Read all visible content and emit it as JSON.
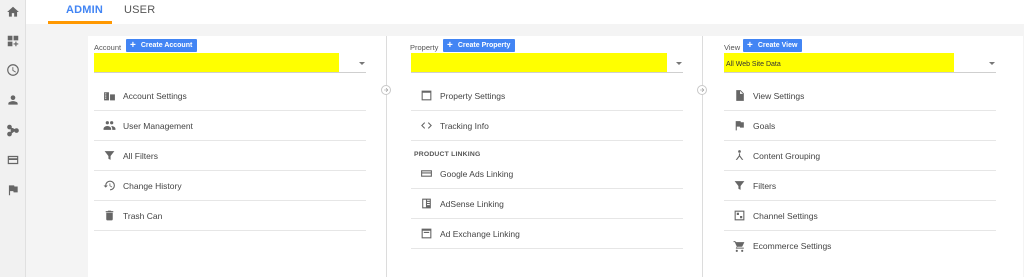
{
  "rail": {
    "icons": [
      "home-icon",
      "dashboard-icon",
      "clock-icon",
      "person-icon",
      "share-icon",
      "card-icon",
      "flag-icon"
    ]
  },
  "tabs": {
    "admin": "ADMIN",
    "user": "USER"
  },
  "account": {
    "label": "Account",
    "create": "Create Account",
    "selected": "",
    "items": [
      {
        "label": "Account Settings",
        "icon": "building-icon"
      },
      {
        "label": "User Management",
        "icon": "people-icon"
      },
      {
        "label": "All Filters",
        "icon": "filter-icon"
      },
      {
        "label": "Change History",
        "icon": "history-icon"
      },
      {
        "label": "Trash Can",
        "icon": "trash-icon"
      }
    ]
  },
  "property": {
    "label": "Property",
    "create": "Create Property",
    "selected": "",
    "items": [
      {
        "label": "Property Settings",
        "icon": "window-icon"
      },
      {
        "label": "Tracking Info",
        "icon": "code-icon"
      }
    ],
    "section": "PRODUCT LINKING",
    "linking": [
      {
        "label": "Google Ads Linking",
        "icon": "ads-icon"
      },
      {
        "label": "AdSense Linking",
        "icon": "adsense-icon"
      },
      {
        "label": "Ad Exchange Linking",
        "icon": "adexchange-icon"
      }
    ]
  },
  "view": {
    "label": "View",
    "create": "Create View",
    "selected": "All Web Site Data",
    "items": [
      {
        "label": "View Settings",
        "icon": "document-icon"
      },
      {
        "label": "Goals",
        "icon": "flag-icon"
      },
      {
        "label": "Content Grouping",
        "icon": "grouping-icon"
      },
      {
        "label": "Filters",
        "icon": "filter-icon"
      },
      {
        "label": "Channel Settings",
        "icon": "channel-icon"
      },
      {
        "label": "Ecommerce Settings",
        "icon": "cart-icon"
      }
    ]
  },
  "colors": {
    "accent": "#4285f4",
    "tab_underline": "#ff9800",
    "highlight": "#ffff00"
  }
}
